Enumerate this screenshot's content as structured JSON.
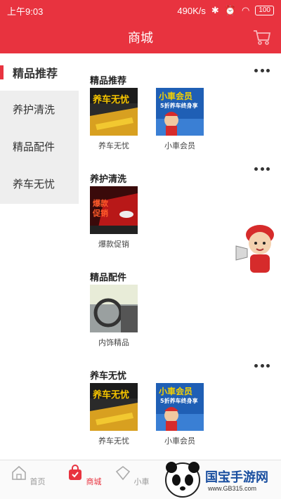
{
  "status": {
    "time": "上午9:03",
    "net_speed": "490K/s",
    "battery": "100"
  },
  "header": {
    "title": "商城"
  },
  "sidebar": {
    "items": [
      {
        "label": "精品推荐",
        "active": true
      },
      {
        "label": "养护清洗",
        "active": false
      },
      {
        "label": "精品配件",
        "active": false
      },
      {
        "label": "养车无忧",
        "active": false
      }
    ]
  },
  "sections": [
    {
      "title": "精品推荐",
      "products": [
        {
          "name": "养车无忧",
          "thumb": "yangche-wuyou"
        },
        {
          "name": "小車会员",
          "thumb": "xiaoche-huiyuan"
        }
      ]
    },
    {
      "title": "养护清洗",
      "products": [
        {
          "name": "爆款促销",
          "thumb": "baokuan-cuxiao"
        }
      ]
    },
    {
      "title": "精品配件",
      "products": [
        {
          "name": "内饰精品",
          "thumb": "neishi-jingpin"
        }
      ]
    },
    {
      "title": "养车无忧",
      "products": [
        {
          "name": "养车无忧",
          "thumb": "yangche-wuyou"
        },
        {
          "name": "小車会员",
          "thumb": "xiaoche-huiyuan"
        }
      ]
    }
  ],
  "thumb_text": {
    "yangche": "养车无忧",
    "xiaoche_top": "小車会员",
    "xiaoche_bottom": "5折养车终身享",
    "baokuan_1": "爆款",
    "baokuan_2": "促销"
  },
  "bottom_nav": [
    {
      "label": "首页",
      "active": false
    },
    {
      "label": "商城",
      "active": true
    },
    {
      "label": "小車",
      "active": false
    }
  ],
  "watermark": {
    "brand": "国宝手游网",
    "url": "www.GB315.com"
  },
  "colors": {
    "accent": "#e8333f",
    "sidebar_bg": "#eeeeee"
  }
}
